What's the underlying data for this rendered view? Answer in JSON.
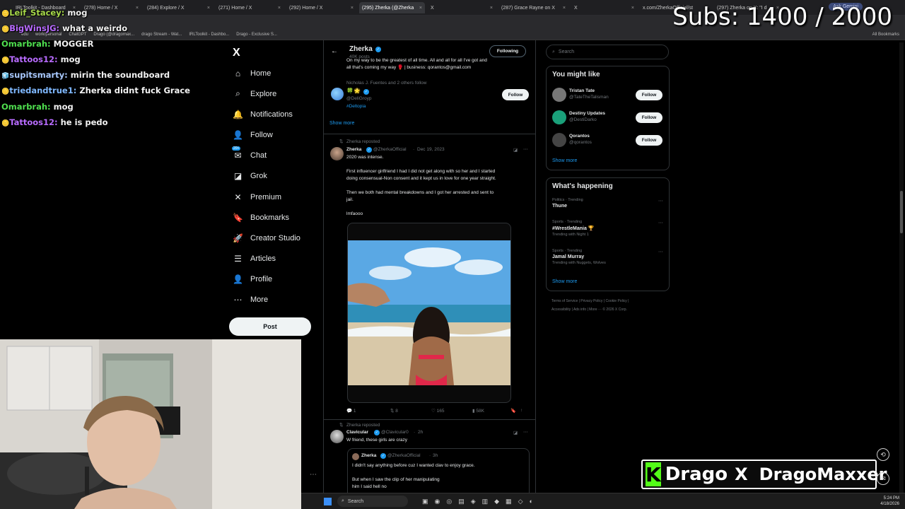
{
  "browser": {
    "tabs": [
      {
        "label": "IRLToolkit - Dashboard"
      },
      {
        "label": "(278) Home / X"
      },
      {
        "label": "(284) Explore / X"
      },
      {
        "label": "(271) Home / X"
      },
      {
        "label": "(292) Home / X"
      },
      {
        "label": "(295) Zherka (@Zherka"
      },
      {
        "label": "X"
      },
      {
        "label": "(287) Grace Rayne on X"
      },
      {
        "label": "X"
      },
      {
        "label": "x.com/ZherkaOfficial/st"
      },
      {
        "label": "(297) Zherka on X: \"I d"
      }
    ],
    "ask_gemini": "Ask Gemini",
    "bookmarks": [
      "edu",
      "work/personal",
      "ChatGPT",
      "Drago (@dragomax...",
      "drago Stream - Wat...",
      "IRLToolkit - Dashbo...",
      "Drago - Exclusive S..."
    ],
    "all_bookmarks": "All Bookmarks"
  },
  "overlay": {
    "subs_text": "Subs: 1400 / 2000",
    "chat": [
      {
        "user": "Leif_Stacey:",
        "message": "mog",
        "color": "#a7d94a",
        "badge": "🪙"
      },
      {
        "user": "BigWinsJG:",
        "message": "what a weirdo",
        "color": "#b86bff",
        "badge": "🪙"
      },
      {
        "user": "Omarbrah:",
        "message": "MOGGER",
        "color": "#4fe04f",
        "badge": ""
      },
      {
        "user": "Tattoos12:",
        "message": "mog",
        "color": "#b86bff",
        "badge": "🪙"
      },
      {
        "user": "supitsmarty:",
        "message": "mirin the soundboard",
        "color": "#a9c9ff",
        "badge": "🧊"
      },
      {
        "user": "triedandtrue1:",
        "message": "Zherka didnt fuck Grace",
        "color": "#7fb8ff",
        "badge": "🪙"
      },
      {
        "user": "Omarbrah:",
        "message": "mog",
        "color": "#4fe04f",
        "badge": ""
      },
      {
        "user": "Tattoos12:",
        "message": "he is pedo",
        "color": "#b86bff",
        "badge": "🪙"
      }
    ],
    "brand": {
      "letter": "K",
      "name": "Drago",
      "x_glyph": "X",
      "handle": "DragoMaxxer"
    }
  },
  "x_nav": {
    "logo": "X",
    "items": [
      {
        "label": "Home",
        "icon": "⌂"
      },
      {
        "label": "Explore",
        "icon": "⌕"
      },
      {
        "label": "Notifications",
        "icon": "🔔"
      },
      {
        "label": "Follow",
        "icon": "👤"
      },
      {
        "label": "Chat",
        "icon": "✉"
      },
      {
        "label": "Grok",
        "icon": "◪"
      },
      {
        "label": "Premium",
        "icon": "✕"
      },
      {
        "label": "Bookmarks",
        "icon": "🔖"
      },
      {
        "label": "Creator Studio",
        "icon": "🚀"
      },
      {
        "label": "Articles",
        "icon": "☰"
      },
      {
        "label": "Profile",
        "icon": "👤"
      },
      {
        "label": "More",
        "icon": "⋯"
      }
    ],
    "chat_badge": "20+",
    "post_label": "Post",
    "more_dots": "⋯"
  },
  "timeline": {
    "header": {
      "name": "Zherka",
      "posts": "40K posts",
      "following_label": "Following"
    },
    "bio_line1": "On my way to be the greatest of all time. All and all for all I've got and",
    "bio_line2": "all that's coming my way 🥊 | business: qorantos@gmail.com",
    "follows_note": "Nicholas J. Fuentes and 2 others follow",
    "suggest_handle": "@DeliGroyp",
    "suggest_tag": "#Deltopia",
    "follow_label": "Follow",
    "show_more": "Show more",
    "tweet1": {
      "repost_note": "Zherka reposted",
      "name": "Zherka",
      "handle": "@ZherkaOfficial",
      "date": "Dec 19, 2023",
      "line1": "2020 was intense.",
      "line2": "First influencer girlfriend I had I did not get along with so her and I started",
      "line3": "doing consensual-Non consent and it kept us in love for one year straight.",
      "line4": "Then we both had mental breakdowns and I got her arrested and sent to",
      "line5": "jail.",
      "line6": "lmfaooo",
      "stats": {
        "replies": "1",
        "reposts": "8",
        "likes": "165",
        "views": "58K"
      }
    },
    "tweet2": {
      "repost_note": "Zherka reposted",
      "name": "Clavicular",
      "handle": "@Clavicular0",
      "time": "2h",
      "text": "W friend, these girls are crazy",
      "quote": {
        "name": "Zherka",
        "handle": "@ZherkaOfficial",
        "time": "3h",
        "line1": "I didn't say anything before cuz I wanted clav to enjoy grace.",
        "line2": "But when I saw the clip of her manipulating",
        "line3": "him I said hell no"
      }
    }
  },
  "right": {
    "search_placeholder": "Search",
    "you_might_like": "You might like",
    "suggestions": [
      {
        "name": "Tristan Tate",
        "handle": "@TateTheTalisman",
        "follow": "Follow",
        "color": "#777"
      },
      {
        "name": "Destiny Updates",
        "handle": "@DestiDarko",
        "follow": "Follow",
        "color": "#1aa07a"
      },
      {
        "name": "Qorantos",
        "handle": "@qorantos",
        "follow": "Follow",
        "color": "#444"
      }
    ],
    "show_more": "Show more",
    "whats_happening": "What's happening",
    "trends": [
      {
        "meta": "Politics · Trending",
        "title": "Thune",
        "sub": ""
      },
      {
        "meta": "Sports · Trending",
        "title": "#WrestleMania 🏆",
        "sub": "Trending with Night 1"
      },
      {
        "meta": "Sports · Trending",
        "title": "Jamal Murray",
        "sub": "Trending with Nuggets, Wolves"
      }
    ],
    "show_more2": "Show more",
    "footer1": "Terms of Service  |  Privacy Policy  |  Cookie Policy  |",
    "footer2": "Accessibility  |  Ads info  |  More ···  © 2026 X Corp."
  },
  "taskbar": {
    "search": "Search",
    "time": "5:24 PM",
    "date": "4/18/2026"
  }
}
